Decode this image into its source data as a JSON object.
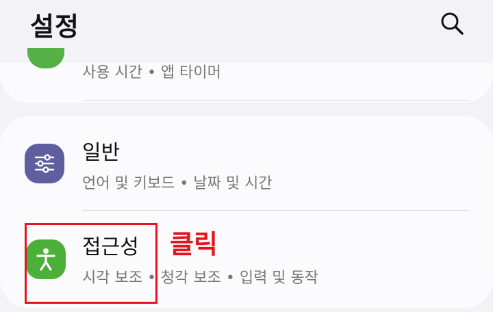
{
  "header": {
    "title": "설정",
    "search_icon": "search-icon"
  },
  "previous_item": {
    "subtitle": "사용 시간 • 앱 타이머",
    "icon_color": "#55b046"
  },
  "items": [
    {
      "title": "일반",
      "subtitle": "언어 및 키보드 • 날짜 및 시간",
      "icon": "sliders-icon",
      "icon_color": "#5f5e9e"
    },
    {
      "title": "접근성",
      "subtitle": "시각 보조 • 청각 보조 • 입력 및 동작",
      "icon": "accessibility-icon",
      "icon_color": "#4caf3a"
    }
  ],
  "annotation": {
    "text": "클릭",
    "color": "#e3141b"
  }
}
